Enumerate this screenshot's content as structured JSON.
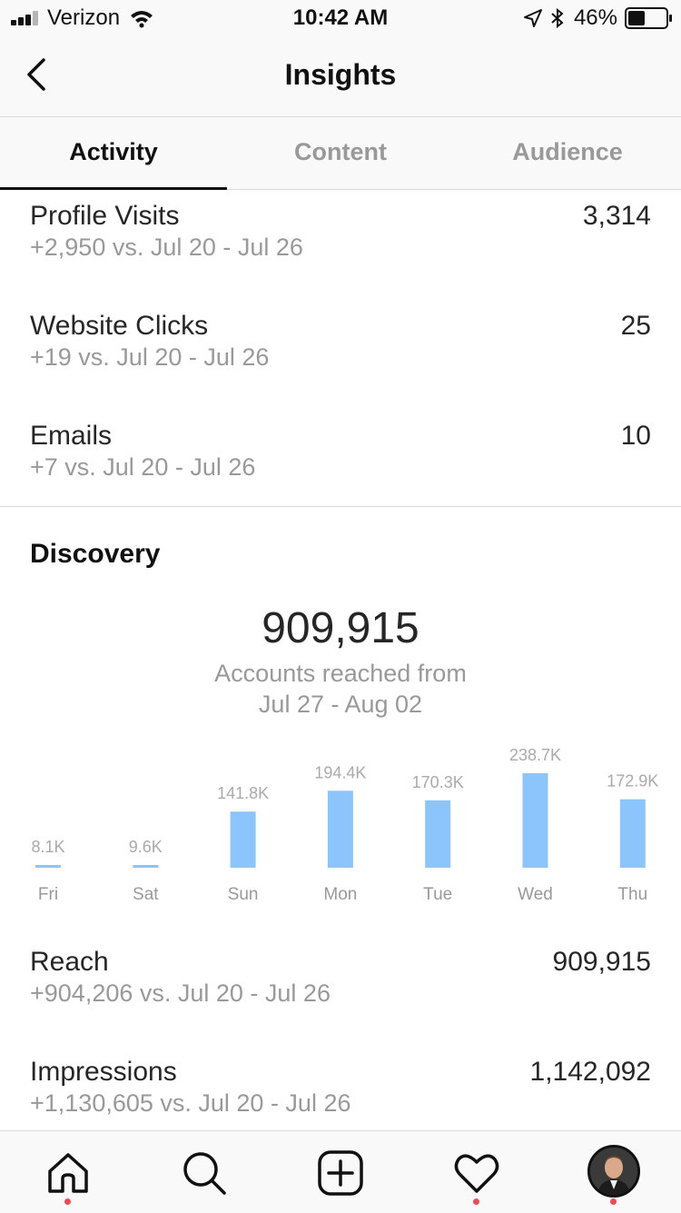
{
  "status_bar": {
    "carrier": "Verizon",
    "time": "10:42 AM",
    "battery": "46%"
  },
  "header": {
    "title": "Insights"
  },
  "tabs": [
    {
      "label": "Activity",
      "active": true
    },
    {
      "label": "Content",
      "active": false
    },
    {
      "label": "Audience",
      "active": false
    }
  ],
  "interactions": [
    {
      "label": "Profile Visits",
      "value": "3,314",
      "comparison": "+2,950 vs. Jul 20 - Jul 26"
    },
    {
      "label": "Website Clicks",
      "value": "25",
      "comparison": "+19 vs. Jul 20 - Jul 26"
    },
    {
      "label": "Emails",
      "value": "10",
      "comparison": "+7 vs. Jul 20 - Jul 26"
    }
  ],
  "discovery": {
    "title": "Discovery",
    "total": "909,915",
    "total_caption_line1": "Accounts reached from",
    "total_caption_line2": "Jul 27 - Aug 02",
    "metrics": [
      {
        "label": "Reach",
        "value": "909,915",
        "comparison": "+904,206 vs. Jul 20 - Jul 26"
      },
      {
        "label": "Impressions",
        "value": "1,142,092",
        "comparison": "+1,130,605 vs. Jul 20 - Jul 26"
      }
    ]
  },
  "chart_data": {
    "type": "bar",
    "categories": [
      "Fri",
      "Sat",
      "Sun",
      "Mon",
      "Tue",
      "Wed",
      "Thu"
    ],
    "values": [
      8100,
      9600,
      141800,
      194400,
      170300,
      238700,
      172900
    ],
    "data_labels": [
      "8.1K",
      "9.6K",
      "141.8K",
      "194.4K",
      "170.3K",
      "238.7K",
      "172.9K"
    ],
    "bar_color": "#8cc5fb",
    "title": "",
    "xlabel": "",
    "ylabel": ""
  },
  "colors": {
    "accent_dot": "#ed4956",
    "bar": "#8cc5fb",
    "muted_text": "#999999"
  },
  "bottom_nav": [
    {
      "icon": "home-icon",
      "notification": true
    },
    {
      "icon": "search-icon",
      "notification": false
    },
    {
      "icon": "add-post-icon",
      "notification": false
    },
    {
      "icon": "heart-icon",
      "notification": true
    },
    {
      "icon": "profile-avatar",
      "notification": true
    }
  ]
}
